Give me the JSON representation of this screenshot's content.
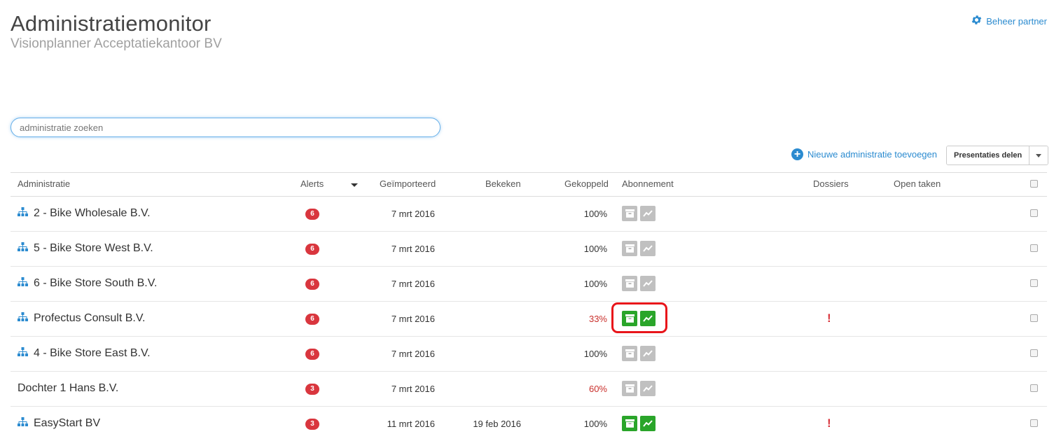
{
  "header": {
    "title": "Administratiemonitor",
    "subtitle": "Visionplanner Acceptatiekantoor BV",
    "partner_link": "Beheer partner"
  },
  "search": {
    "placeholder": "administratie zoeken"
  },
  "toolbar": {
    "add_label": "Nieuwe administratie toevoegen",
    "share_label": "Presentaties delen"
  },
  "table": {
    "columns": {
      "administratie": "Administratie",
      "alerts": "Alerts",
      "geimporteerd": "Geïmporteerd",
      "bekeken": "Bekeken",
      "gekoppeld": "Gekoppeld",
      "abonnement": "Abonnement",
      "dossiers": "Dossiers",
      "open_taken": "Open taken"
    },
    "rows": [
      {
        "name": "2 - Bike Wholesale B.V.",
        "hierarchy_icon": true,
        "alerts": "6",
        "imported": "7 mrt 2016",
        "viewed": "",
        "linked": "100%",
        "linked_warning": false,
        "subscription_active": false,
        "dossier_flag": ""
      },
      {
        "name": "5 - Bike Store West B.V.",
        "hierarchy_icon": true,
        "alerts": "6",
        "imported": "7 mrt 2016",
        "viewed": "",
        "linked": "100%",
        "linked_warning": false,
        "subscription_active": false,
        "dossier_flag": ""
      },
      {
        "name": "6 - Bike Store South B.V.",
        "hierarchy_icon": true,
        "alerts": "6",
        "imported": "7 mrt 2016",
        "viewed": "",
        "linked": "100%",
        "linked_warning": false,
        "subscription_active": false,
        "dossier_flag": ""
      },
      {
        "name": "Profectus Consult B.V.",
        "hierarchy_icon": true,
        "alerts": "6",
        "imported": "7 mrt 2016",
        "viewed": "",
        "linked": "33%",
        "linked_warning": true,
        "subscription_active": true,
        "dossier_flag": "!"
      },
      {
        "name": "4 - Bike Store East B.V.",
        "hierarchy_icon": true,
        "alerts": "6",
        "imported": "7 mrt 2016",
        "viewed": "",
        "linked": "100%",
        "linked_warning": false,
        "subscription_active": false,
        "dossier_flag": ""
      },
      {
        "name": "Dochter 1 Hans B.V.",
        "hierarchy_icon": false,
        "alerts": "3",
        "imported": "7 mrt 2016",
        "viewed": "",
        "linked": "60%",
        "linked_warning": true,
        "subscription_active": false,
        "dossier_flag": ""
      },
      {
        "name": "EasyStart BV",
        "hierarchy_icon": true,
        "alerts": "3",
        "imported": "11 mrt 2016",
        "viewed": "19 feb 2016",
        "linked": "100%",
        "linked_warning": false,
        "subscription_active": true,
        "dossier_flag": "!"
      }
    ]
  },
  "colors": {
    "accent": "#2b8bd0",
    "alert": "#d9363e",
    "active_subscription": "#2aa52a",
    "inactive_subscription": "#c0c0c0",
    "highlight": "#e8141a"
  },
  "icons": [
    "gear-icon",
    "plus-circle-icon",
    "hierarchy-icon",
    "archive-icon",
    "trend-chart-icon",
    "sort-caret-icon",
    "caret-down-icon"
  ]
}
